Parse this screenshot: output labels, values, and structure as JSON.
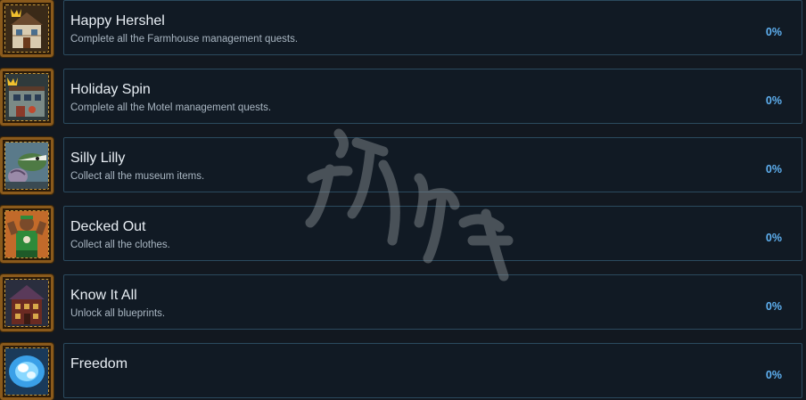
{
  "achievements": [
    {
      "title": "Happy Hershel",
      "description": "Complete all the Farmhouse management quests.",
      "percent": "0%",
      "icon": "farmhouse-icon"
    },
    {
      "title": "Holiday Spin",
      "description": "Complete all the Motel management quests.",
      "percent": "0%",
      "icon": "motel-icon"
    },
    {
      "title": "Silly Lilly",
      "description": "Collect all the museum items.",
      "percent": "0%",
      "icon": "museum-creature-icon"
    },
    {
      "title": "Decked Out",
      "description": "Collect all the clothes.",
      "percent": "0%",
      "icon": "outfit-character-icon"
    },
    {
      "title": "Know It All",
      "description": "Unlock all blueprints.",
      "percent": "0%",
      "icon": "blueprint-house-icon"
    },
    {
      "title": "Freedom",
      "description": "",
      "percent": "0%",
      "icon": "blue-eye-icon"
    }
  ],
  "watermark": {
    "text": "游侠网"
  },
  "colors": {
    "background": "#121820",
    "card_border": "#2b4a5e",
    "percent": "#5fb1f2",
    "icon_frame": "#8a5a1c"
  }
}
